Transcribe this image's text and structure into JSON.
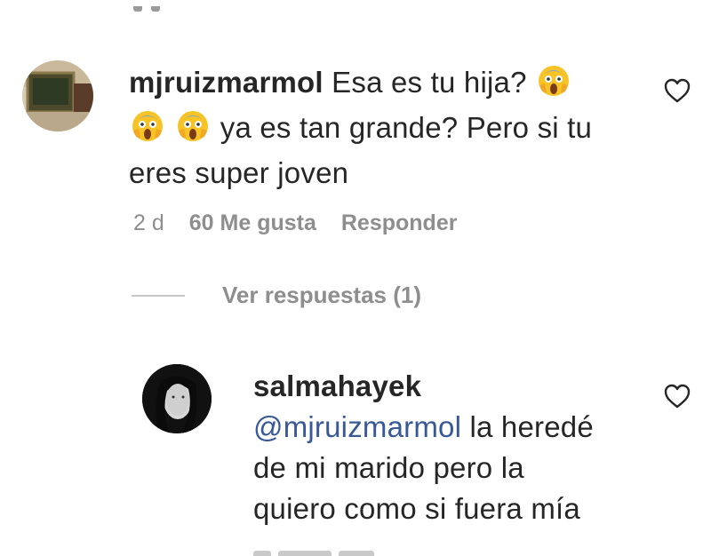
{
  "comment": {
    "username": "mjruizmarmol",
    "text_line1": "Esa es tu hija?",
    "text_line2": "ya es tan grande? Pero si tu",
    "text_line3": "eres super joven",
    "emoji": "face-screaming-in-fear",
    "time": "2 d",
    "likes": "60 Me gusta",
    "reply_label": "Responder",
    "view_replies": "Ver respuestas (1)"
  },
  "reply": {
    "username": "salmahayek",
    "mention": "@mjruizmarmol",
    "text_line1": " la heredé",
    "text_line2": "de mi marido pero la",
    "text_line3": "quiero como si fuera mía"
  },
  "icons": {
    "like": "heart-outline-icon",
    "accent_mention": "#385898",
    "meta_gray": "#8e8e8e"
  }
}
